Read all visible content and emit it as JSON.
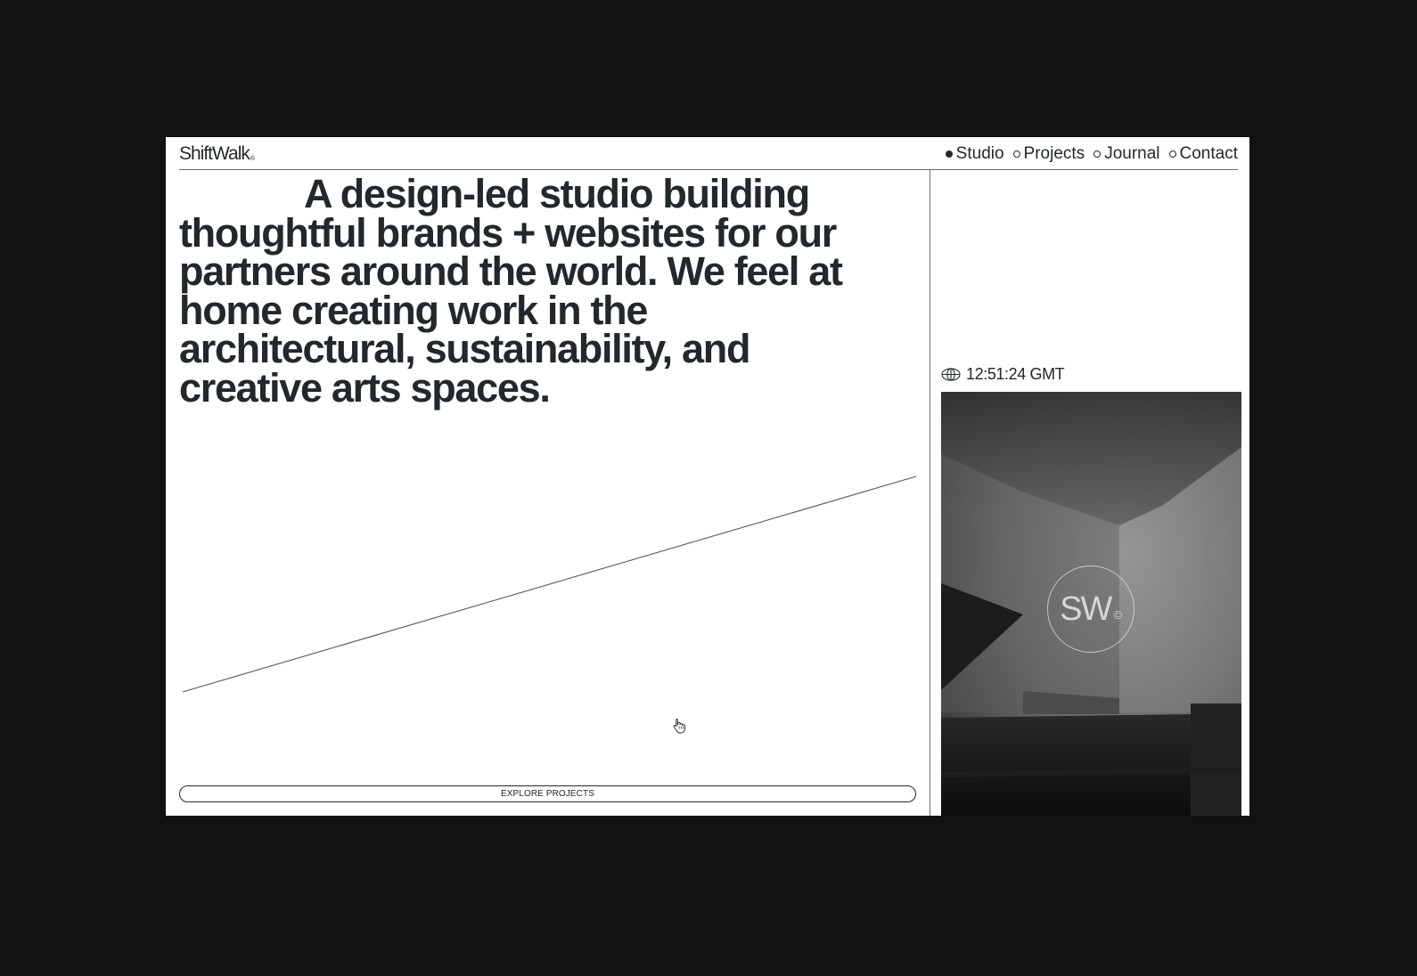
{
  "brand": {
    "name": "ShiftWalk",
    "mark": "®"
  },
  "nav": {
    "items": [
      {
        "label": "Studio",
        "active": true
      },
      {
        "label": "Projects",
        "active": false
      },
      {
        "label": "Journal",
        "active": false
      },
      {
        "label": "Contact",
        "active": false
      }
    ]
  },
  "hero": {
    "headline": "A design-led studio building thoughtful brands + websites for our partners around the world. We feel at home creating work in the architectural, sustainability, and creative arts spaces."
  },
  "cta": {
    "explore_label": "EXPLORE PROJECTS"
  },
  "sidebar": {
    "time": "12:51:24 GMT",
    "time_icon": "globe-icon",
    "badge_text": "SW",
    "badge_mark": "©"
  },
  "colors": {
    "page_background": "#111212",
    "surface": "#ffffff",
    "ink": "#22282b",
    "rule": "#6a6e70"
  }
}
